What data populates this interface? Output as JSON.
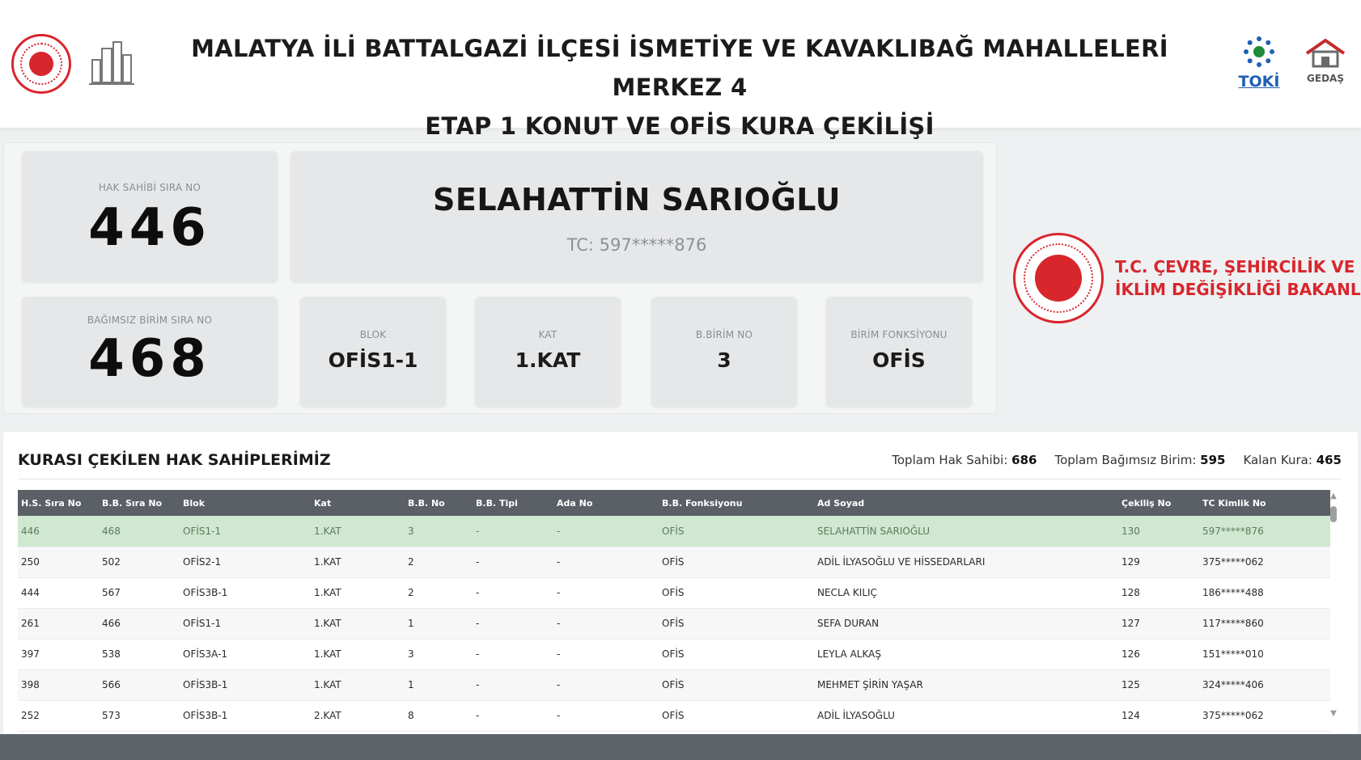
{
  "header": {
    "title_line1": "MALATYA İLİ BATTALGAZİ İLÇESİ İSMETİYE VE KAVAKLIBAĞ MAHALLELERİ MERKEZ 4",
    "title_line2": "ETAP 1 KONUT VE OFİS KURA ÇEKİLİŞİ",
    "toki_label": "TOKİ",
    "gedas_label": "GEDAŞ"
  },
  "winner": {
    "hak_sahibi_label": "HAK SAHİBİ SIRA NO",
    "hak_sahibi_no": "446",
    "bagimsiz_label": "BAĞIMSIZ BİRİM SIRA NO",
    "bagimsiz_no": "468",
    "name": "SELAHATTİN SARIOĞLU",
    "tc": "TC: 597*****876",
    "details": [
      {
        "label": "BLOK",
        "value": "OFİS1-1"
      },
      {
        "label": "KAT",
        "value": "1.KAT"
      },
      {
        "label": "B.BİRİM NO",
        "value": "3"
      },
      {
        "label": "BİRİM FONKSİYONU",
        "value": "OFİS"
      }
    ]
  },
  "ministry": {
    "line1": "T.C. ÇEVRE, ŞEHİRCİLİK VE",
    "line2": "İKLİM DEĞİŞİKLİĞİ BAKANLIĞI"
  },
  "results": {
    "title": "KURASI ÇEKİLEN HAK SAHİPLERİMİZ",
    "stats": [
      {
        "label": "Toplam Hak Sahibi:",
        "value": "686"
      },
      {
        "label": "Toplam Bağımsız Birim:",
        "value": "595"
      },
      {
        "label": "Kalan Kura:",
        "value": "465"
      }
    ],
    "columns": [
      "H.S. Sıra No",
      "B.B. Sıra No",
      "Blok",
      "Kat",
      "B.B. No",
      "B.B. Tipi",
      "Ada No",
      "B.B. Fonksiyonu",
      "Ad Soyad",
      "Çekiliş No",
      "TC Kimlik No"
    ],
    "rows": [
      [
        "446",
        "468",
        "OFİS1-1",
        "1.KAT",
        "3",
        "-",
        "-",
        "OFİS",
        "SELAHATTİN SARIOĞLU",
        "130",
        "597*****876"
      ],
      [
        "250",
        "502",
        "OFİS2-1",
        "1.KAT",
        "2",
        "-",
        "-",
        "OFİS",
        "ADİL İLYASOĞLU VE HİSSEDARLARI",
        "129",
        "375*****062"
      ],
      [
        "444",
        "567",
        "OFİS3B-1",
        "1.KAT",
        "2",
        "-",
        "-",
        "OFİS",
        "NECLA KILIÇ",
        "128",
        "186*****488"
      ],
      [
        "261",
        "466",
        "OFİS1-1",
        "1.KAT",
        "1",
        "-",
        "-",
        "OFİS",
        "SEFA DURAN",
        "127",
        "117*****860"
      ],
      [
        "397",
        "538",
        "OFİS3A-1",
        "1.KAT",
        "3",
        "-",
        "-",
        "OFİS",
        "LEYLA ALKAŞ",
        "126",
        "151*****010"
      ],
      [
        "398",
        "566",
        "OFİS3B-1",
        "1.KAT",
        "1",
        "-",
        "-",
        "OFİS",
        "MEHMET ŞİRİN YAŞAR",
        "125",
        "324*****406"
      ],
      [
        "252",
        "573",
        "OFİS3B-1",
        "2.KAT",
        "8",
        "-",
        "-",
        "OFİS",
        "ADİL İLYASOĞLU",
        "124",
        "375*****062"
      ]
    ]
  }
}
